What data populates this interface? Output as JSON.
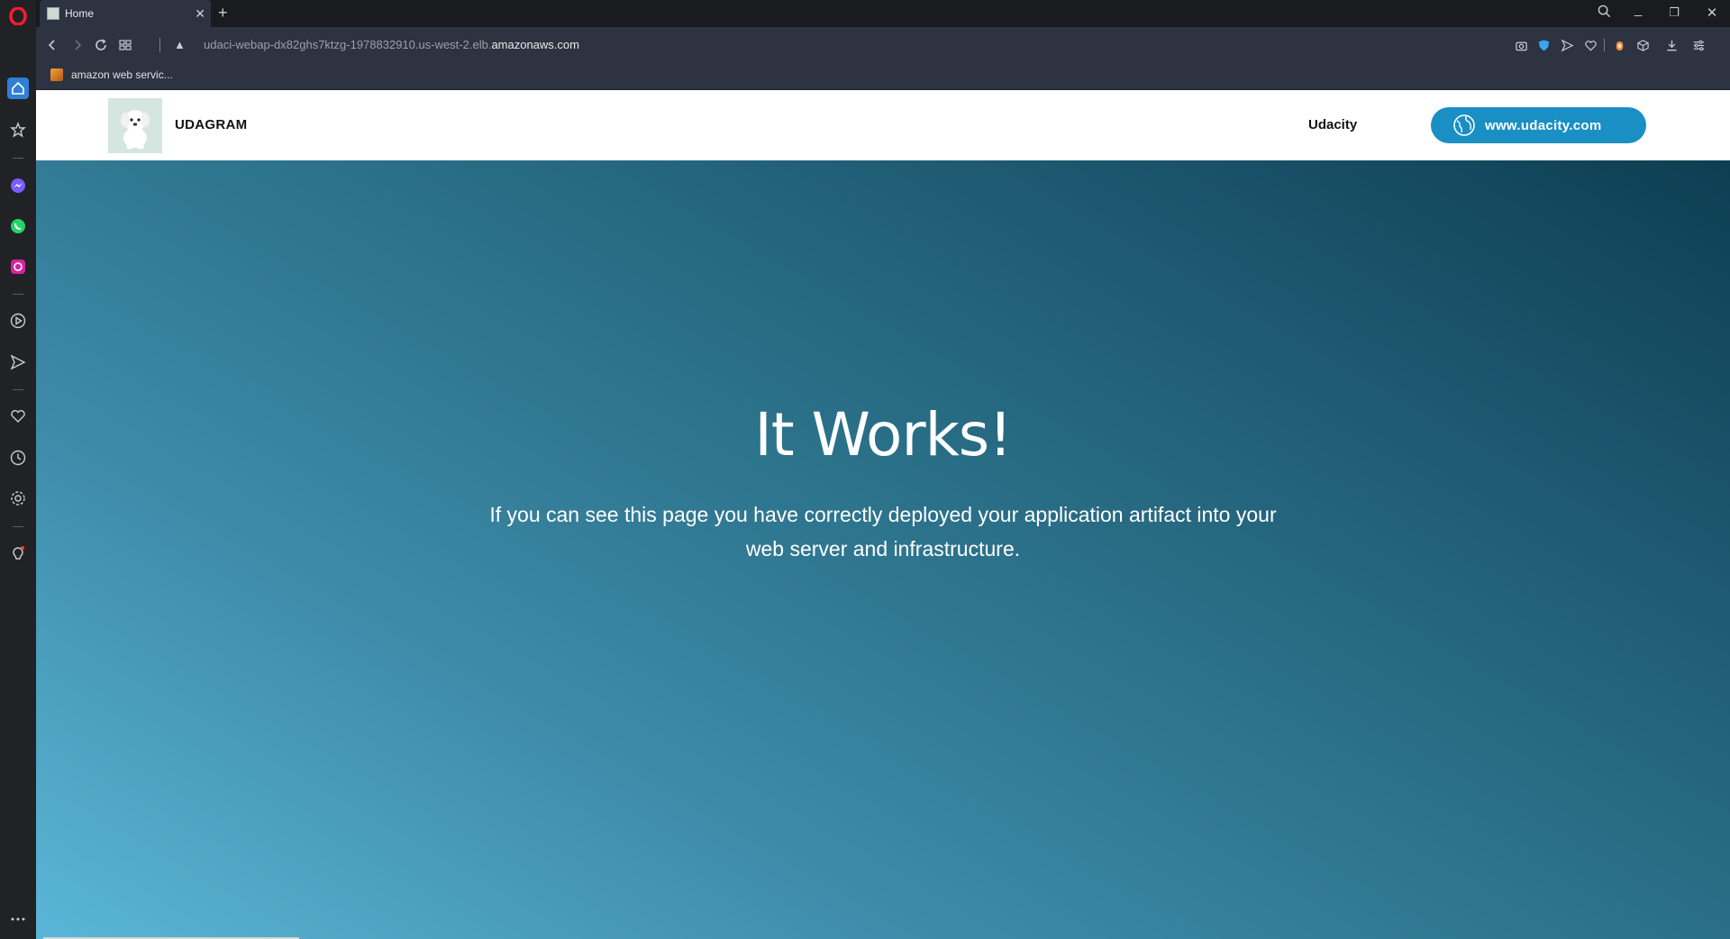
{
  "browser": {
    "tab_title": "Home",
    "new_tab": "+",
    "url_path": "udaci-webap-dx82ghs7ktzg-1978832910.us-west-2.elb.",
    "url_domain": "amazonaws.com",
    "bookmark_label": "amazon web servic...",
    "toolbar_icons": [
      "camera-icon",
      "shield-icon",
      "send-icon",
      "heart-icon",
      "extension-icon",
      "cube-icon",
      "download-icon",
      "easy-setup-icon"
    ],
    "sidebar_icons": [
      "home-icon",
      "star-icon",
      "messenger-icon",
      "whatsapp-icon",
      "instagram-icon",
      "player-icon",
      "send-icon",
      "heart-icon",
      "history-icon",
      "settings-icon",
      "lightbulb-icon",
      "more-icon"
    ],
    "colors": {
      "sidebar_bg": "#202226",
      "toolbar_bg": "#2d3340"
    }
  },
  "site": {
    "brand": "UDAGRAM",
    "nav_link": "Udacity",
    "cta_label": "www.udacity.com",
    "colors": {
      "accent": "#1a8fc4"
    }
  },
  "hero": {
    "title": "It Works!",
    "text": "If you can see this page you have correctly deployed your application artifact into your web server and infrastructure."
  }
}
